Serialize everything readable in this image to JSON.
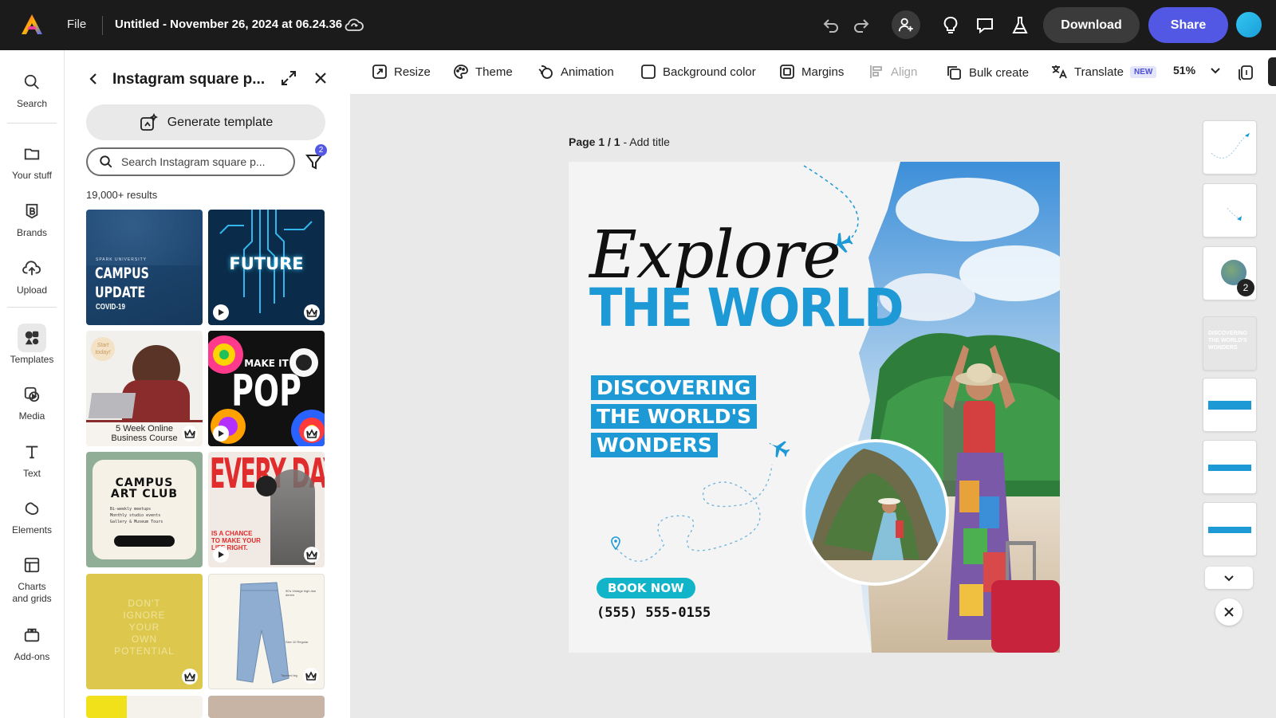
{
  "app": {
    "file_menu": "File",
    "document_title": "Untitled - November 26, 2024 at 06.24.36",
    "download_label": "Download",
    "share_label": "Share",
    "colors": {
      "accent": "#5258e4",
      "topbar": "#1b1b1b",
      "brand_blue": "#1d9ad6"
    }
  },
  "rail": {
    "items": [
      {
        "label": "Search",
        "icon": "search-icon"
      },
      {
        "label": "Your stuff",
        "icon": "folder-icon"
      },
      {
        "label": "Brands",
        "icon": "brand-icon"
      },
      {
        "label": "Upload",
        "icon": "upload-icon"
      },
      {
        "label": "Templates",
        "icon": "templates-icon",
        "active": true
      },
      {
        "label": "Media",
        "icon": "media-icon"
      },
      {
        "label": "Text",
        "icon": "text-icon"
      },
      {
        "label": "Elements",
        "icon": "elements-icon"
      },
      {
        "label": "Charts and grids",
        "icon": "charts-icon"
      },
      {
        "label": "Add-ons",
        "icon": "addons-icon"
      }
    ]
  },
  "panel": {
    "title": "Instagram square p...",
    "generate_label": "Generate template",
    "search_placeholder": "Search Instagram square p...",
    "filter_count": "2",
    "results": "19,000+ results",
    "templates": [
      {
        "name": "campus-update",
        "lines": [
          "SPARK UNIVERSITY",
          "CAMPUS",
          "UPDATE",
          "COVID-19"
        ]
      },
      {
        "name": "future",
        "lines": [
          "FUTURE"
        ]
      },
      {
        "name": "online-business-course",
        "lines": [
          "Start today!",
          "5 Week Online",
          "Business Course"
        ]
      },
      {
        "name": "make-it-pop",
        "lines": [
          "MAKE IT",
          "POP"
        ]
      },
      {
        "name": "campus-art-club",
        "lines": [
          "CAMPUS",
          "ART CLUB",
          "Bi-weekly meetups",
          "Monthly studio events",
          "Gallery & Museum Tours"
        ]
      },
      {
        "name": "every-day",
        "lines": [
          "EVERY DAY",
          "IS A CHANCE",
          "TO MAKE YOUR",
          "LIFE RIGHT."
        ]
      },
      {
        "name": "dont-ignore",
        "lines": [
          "DON'T",
          "IGNORE",
          "YOUR",
          "OWN",
          "POTENTIAL"
        ]
      },
      {
        "name": "jeans",
        "lines": [
          "90's Vintage high-rise denim",
          "Size 10 Regular",
          "Tapered leg"
        ]
      }
    ]
  },
  "toolbar": {
    "resize": "Resize",
    "theme": "Theme",
    "animation": "Animation",
    "background_color": "Background color",
    "margins": "Margins",
    "align": "Align",
    "bulk_create": "Bulk create",
    "translate": "Translate",
    "new_badge": "NEW",
    "zoom": "51%"
  },
  "canvas": {
    "page_number": "Page 1 / 1",
    "page_sep": " - ",
    "add_title": "Add title",
    "explore": "Explore",
    "the_world": "THE WORLD",
    "discover_lines": [
      "DISCOVERING",
      "THE WORLD'S",
      "WONDERS"
    ],
    "book_now": "BOOK NOW",
    "phone": "(555) 555-0155"
  },
  "layers": {
    "group_count": "2",
    "text_thumb": "DISCOVERING THE WORLD'S WONDERS"
  }
}
